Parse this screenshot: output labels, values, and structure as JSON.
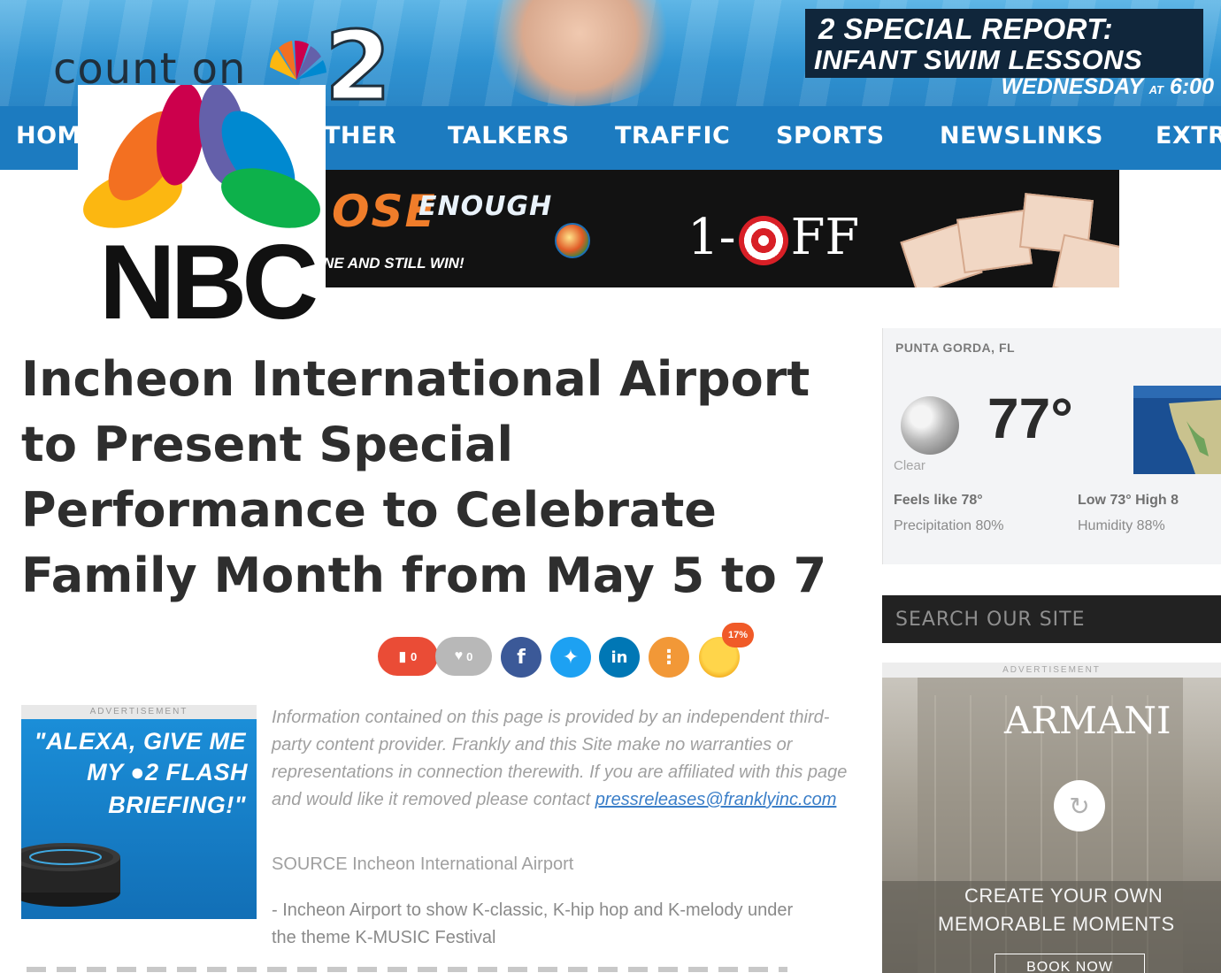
{
  "header": {
    "count_on_text": "count on",
    "special_report_line1": "2 SPECIAL REPORT:",
    "special_report_line2": "INFANT SWIM LESSONS",
    "special_report_day": "WEDNESDAY",
    "special_report_at": "AT",
    "special_report_time": "6:00"
  },
  "nav": {
    "items": [
      {
        "label": "HOM"
      },
      {
        "label": "THER"
      },
      {
        "label": "TALKERS"
      },
      {
        "label": "TRAFFIC"
      },
      {
        "label": "SPORTS"
      },
      {
        "label": "NEWSLINKS"
      },
      {
        "label": "EXTR"
      }
    ]
  },
  "top_ad": {
    "close_text": "OSE",
    "enough_text": "ENOUGH",
    "still_win_text": "NE AND STILL WIN!",
    "one_off_text": "1-",
    "one_off_tail": "FF"
  },
  "logo": {
    "text": "NBC",
    "colors": [
      "#f37021",
      "#cc004c",
      "#6460aa",
      "#0089d0",
      "#0db14b",
      "#fcb711"
    ]
  },
  "article": {
    "headline": "Incheon International Airport to Present Special Performance to Celebrate Family Month from May 5 to 7",
    "disclaimer": "Information contained on this page is provided by an independent third-party content provider. Frankly and this Site make no warranties or representations in connection therewith. If you are affiliated with this page and would like it removed please contact",
    "contact_email": "pressreleases@franklyinc.com",
    "source": "SOURCE Incheon International Airport",
    "bullet": "- Incheon Airport to show K-classic, K-hip hop and K-melody under the theme K-MUSIC Festival"
  },
  "share": {
    "comments_count": "0",
    "likes_count": "0",
    "reaction_badge": "17%",
    "icons": {
      "comment": "comment-icon",
      "like": "heart-icon",
      "facebook": "facebook-icon",
      "twitter": "twitter-icon",
      "linkedin": "linkedin-icon",
      "more": "more-icon",
      "reaction": "laughing-emoji-icon"
    },
    "colors": {
      "facebook": "#3b5998",
      "twitter": "#1da1f2",
      "linkedin": "#0077b5",
      "more": "#f29837"
    }
  },
  "alexa_ad": {
    "label": "ADVERTISEMENT",
    "line1": "\"ALEXA, GIVE ME",
    "line2_pre": "MY",
    "line2_post": "FLASH",
    "line3": "BRIEFING!\""
  },
  "weather": {
    "city": "PUNTA GORDA, FL",
    "temperature": "77°",
    "condition": "Clear",
    "feels_like": "Feels like 78°",
    "low_high": "Low 73° High 8",
    "precipitation": "Precipitation 80%",
    "humidity": "Humidity 88%",
    "icon": "moon-icon"
  },
  "search": {
    "placeholder": "SEARCH OUR SITE"
  },
  "armani_ad": {
    "label": "ADVERTISEMENT",
    "title": "ARMANI",
    "line1": "CREATE YOUR OWN",
    "line2": "MEMORABLE MOMENTS",
    "button": "BOOK NOW"
  }
}
